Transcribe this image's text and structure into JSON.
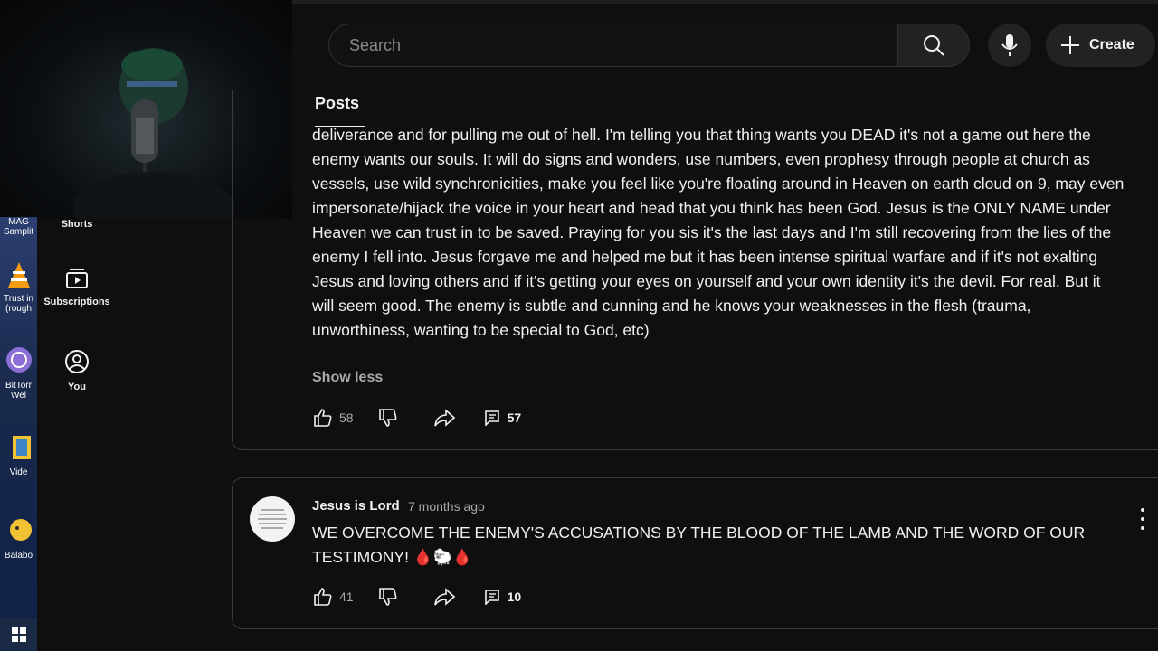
{
  "masthead": {
    "search_placeholder": "Search",
    "create_label": "Create"
  },
  "guide": {
    "items": [
      {
        "label": "Shorts",
        "icon": "shorts-icon"
      },
      {
        "label": "Subscriptions",
        "icon": "subscriptions-icon"
      },
      {
        "label": "You",
        "icon": "you-icon"
      }
    ]
  },
  "desktop": {
    "icons": [
      {
        "label": "MAG Samplit"
      },
      {
        "label": "Trust in (rough"
      },
      {
        "label": "BitTorr Wel"
      },
      {
        "label": "Vide"
      },
      {
        "label": "Balabo"
      }
    ]
  },
  "tab": {
    "label": "Posts"
  },
  "posts": [
    {
      "body": "deliverance and for pulling me out of hell. I'm telling you that thing wants you DEAD it's not a game out here the enemy wants our souls. It will do signs and wonders, use numbers, even prophesy through people at church as vessels, use wild synchronicities, make you feel like you're floating around in Heaven on earth cloud on 9, may even impersonate/hijack the voice in your heart and head that you think has been God. Jesus is the ONLY NAME under Heaven we can trust in to be saved. Praying for you sis it's the last days and I'm still recovering from the lies of the enemy I fell into. Jesus forgave me and helped me but it has been intense spiritual warfare and if it's not exalting Jesus and loving others and if it's getting your eyes on yourself and your own identity it's the devil. For real. But it will seem good. The enemy is subtle and cunning and he knows your weaknesses in the flesh (trauma, unworthiness, wanting to be special to God, etc)",
      "show_less": "Show less",
      "likes": "58",
      "replies": "57"
    },
    {
      "author": "Jesus is Lord",
      "time": "7 months ago",
      "body": "WE OVERCOME THE ENEMY'S ACCUSATIONS BY THE BLOOD OF THE LAMB AND THE WORD OF OUR TESTIMONY! 🩸🐑🩸",
      "likes": "41",
      "replies": "10"
    }
  ]
}
